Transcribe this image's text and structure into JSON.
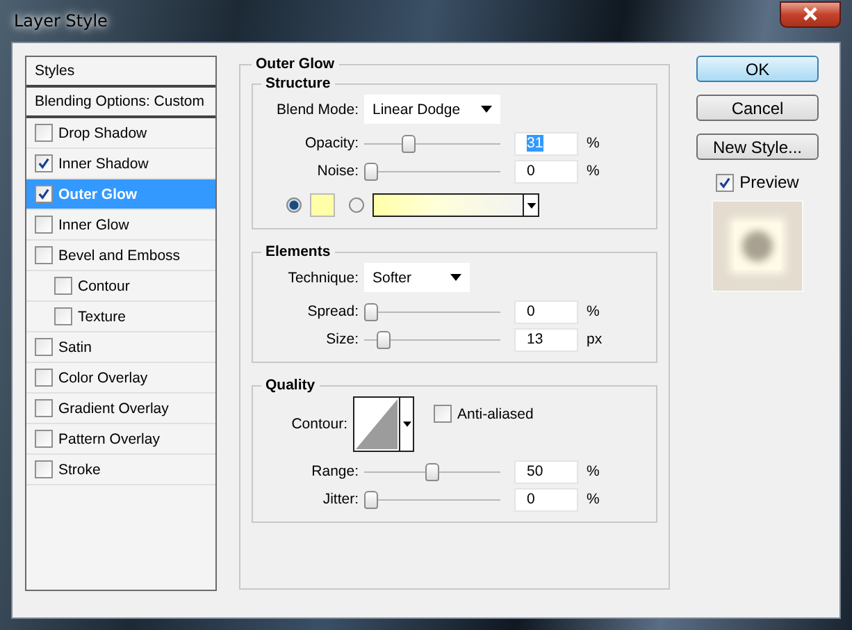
{
  "window": {
    "title": "Layer Style"
  },
  "sidebar": {
    "items": [
      {
        "label": "Styles",
        "kind": "header",
        "selected": false
      },
      {
        "label": "Blending Options: Custom",
        "kind": "header",
        "selected": false
      },
      {
        "label": "Drop Shadow",
        "kind": "check",
        "checked": false,
        "selected": false
      },
      {
        "label": "Inner Shadow",
        "kind": "check",
        "checked": true,
        "selected": false
      },
      {
        "label": "Outer Glow",
        "kind": "check",
        "checked": true,
        "selected": true
      },
      {
        "label": "Inner Glow",
        "kind": "check",
        "checked": false,
        "selected": false
      },
      {
        "label": "Bevel and Emboss",
        "kind": "check",
        "checked": false,
        "selected": false,
        "children": [
          {
            "label": "Contour",
            "kind": "check",
            "checked": false,
            "selected": false
          },
          {
            "label": "Texture",
            "kind": "check",
            "checked": false,
            "selected": false
          }
        ]
      },
      {
        "label": "Satin",
        "kind": "check",
        "checked": false,
        "selected": false
      },
      {
        "label": "Color Overlay",
        "kind": "check",
        "checked": false,
        "selected": false
      },
      {
        "label": "Gradient Overlay",
        "kind": "check",
        "checked": false,
        "selected": false
      },
      {
        "label": "Pattern Overlay",
        "kind": "check",
        "checked": false,
        "selected": false
      },
      {
        "label": "Stroke",
        "kind": "check",
        "checked": false,
        "selected": false
      }
    ]
  },
  "outer_glow": {
    "title": "Outer Glow",
    "structure": {
      "title": "Structure",
      "blend_mode": {
        "label": "Blend Mode:",
        "value": "Linear Dodge"
      },
      "sliders": [
        {
          "label": "Opacity:",
          "level": 0.31,
          "value": "31",
          "unit": "%",
          "highlighted": true
        },
        {
          "label": "Noise:",
          "level": 0,
          "value": "0",
          "unit": "%",
          "highlighted": false
        }
      ],
      "fill_options": [
        {
          "kind": "swatch",
          "selected": true
        },
        {
          "kind": "gradient",
          "selected": false
        }
      ]
    },
    "elements": {
      "title": "Elements",
      "technique": {
        "label": "Technique:",
        "value": "Softer"
      },
      "sliders": [
        {
          "label": "Spread:",
          "level": 0,
          "value": "0",
          "unit": "%",
          "highlighted": false
        },
        {
          "label": "Size:",
          "level": 0.1,
          "value": "13",
          "unit": "px",
          "highlighted": false
        }
      ]
    },
    "quality": {
      "title": "Quality",
      "contour_label": "Contour:",
      "anti_aliased": {
        "label": "Anti-aliased",
        "checked": false
      },
      "sliders": [
        {
          "label": "Range:",
          "level": 0.5,
          "value": "50",
          "unit": "%",
          "highlighted": false
        },
        {
          "label": "Jitter:",
          "level": 0,
          "value": "0",
          "unit": "%",
          "highlighted": false
        }
      ]
    }
  },
  "buttons": [
    {
      "label": "OK",
      "default": true
    },
    {
      "label": "Cancel",
      "default": false
    },
    {
      "label": "New Style...",
      "default": false
    }
  ],
  "preview": {
    "label": "Preview",
    "checked": true
  }
}
